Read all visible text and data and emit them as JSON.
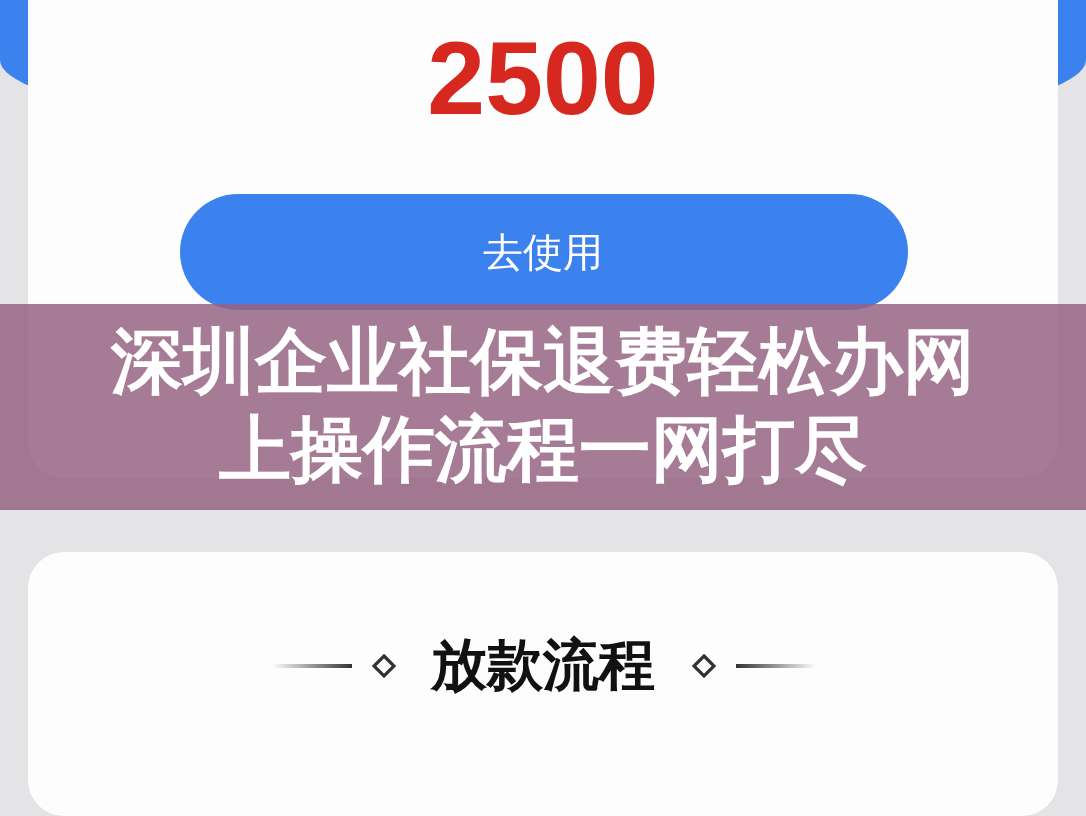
{
  "amount": "2500",
  "action_button": "去使用",
  "banner": {
    "title": "深圳企业社保退费轻松办网上操作流程一网打尽"
  },
  "section": {
    "title": "放款流程"
  }
}
